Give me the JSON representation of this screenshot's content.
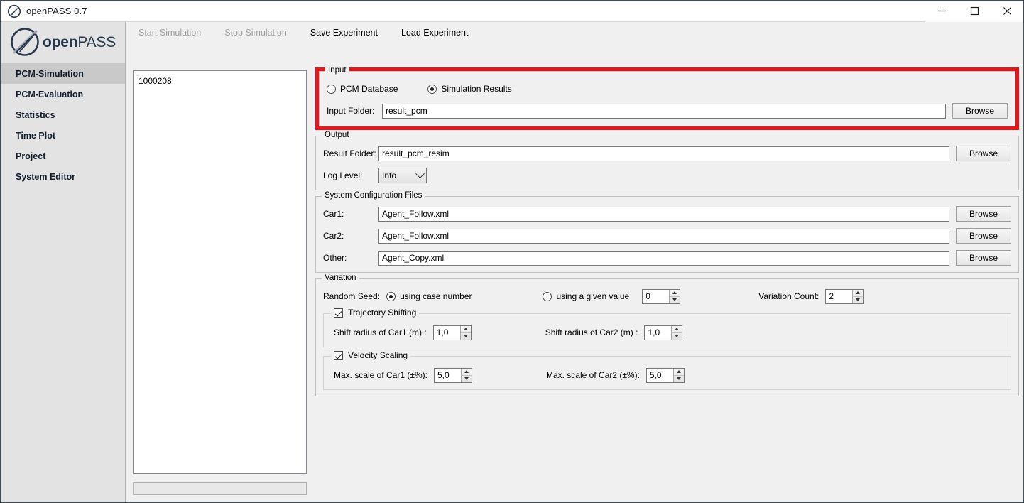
{
  "window": {
    "title": "openPASS 0.7",
    "app_icon": "openpass-logo-icon",
    "minimize_label": "minimize-icon",
    "maximize_label": "maximize-icon",
    "close_label": "close-icon"
  },
  "sidebar": {
    "logo_bold": "open",
    "logo_light": "PASS",
    "items": [
      {
        "label": "PCM-Simulation",
        "active": true
      },
      {
        "label": "PCM-Evaluation",
        "active": false
      },
      {
        "label": "Statistics",
        "active": false
      },
      {
        "label": "Time Plot",
        "active": false
      },
      {
        "label": "Project",
        "active": false
      },
      {
        "label": "System Editor",
        "active": false
      }
    ]
  },
  "toolbar": {
    "items": [
      {
        "label": "Start Simulation",
        "disabled": true
      },
      {
        "label": "Stop Simulation",
        "disabled": true
      },
      {
        "label": "Save Experiment",
        "disabled": false
      },
      {
        "label": "Load Experiment",
        "disabled": false
      }
    ]
  },
  "case_list": {
    "items": [
      "1000208"
    ]
  },
  "progress": {
    "value": ""
  },
  "input_group": {
    "title": "Input",
    "highlighted": true,
    "highlight_color": "#e8161a",
    "radio_pcm_database": {
      "label": "PCM Database",
      "selected": false
    },
    "radio_simulation_results": {
      "label": "Simulation Results",
      "selected": true
    },
    "input_folder_label": "Input Folder:",
    "input_folder_value": "result_pcm",
    "browse_label": "Browse"
  },
  "output_group": {
    "title": "Output",
    "result_folder_label": "Result Folder:",
    "result_folder_value": "result_pcm_resim",
    "browse_label": "Browse",
    "log_level_label": "Log Level:",
    "log_level_value": "Info"
  },
  "system_config_group": {
    "title": "System Configuration Files",
    "rows": [
      {
        "label": "Car1:",
        "value": "Agent_Follow.xml",
        "browse": "Browse"
      },
      {
        "label": "Car2:",
        "value": "Agent_Follow.xml",
        "browse": "Browse"
      },
      {
        "label": "Other:",
        "value": "Agent_Copy.xml",
        "browse": "Browse"
      }
    ]
  },
  "variation_group": {
    "title": "Variation",
    "random_seed_label": "Random Seed:",
    "radio_case_number": {
      "label": "using case number",
      "selected": true
    },
    "radio_given_value": {
      "label": "using a given value",
      "selected": false
    },
    "given_value": "0",
    "variation_count_label": "Variation Count:",
    "variation_count_value": "2",
    "trajectory_shifting": {
      "title": "Trajectory Shifting",
      "checked": true,
      "car1_label": "Shift radius of Car1 (m) :",
      "car1_value": "1,0",
      "car2_label": "Shift radius of Car2 (m) :",
      "car2_value": "1,0"
    },
    "velocity_scaling": {
      "title": "Velocity Scaling",
      "checked": true,
      "car1_label": "Max. scale of Car1 (±%):",
      "car1_value": "5,0",
      "car2_label": "Max. scale of Car2 (±%):",
      "car2_value": "5,0"
    }
  }
}
